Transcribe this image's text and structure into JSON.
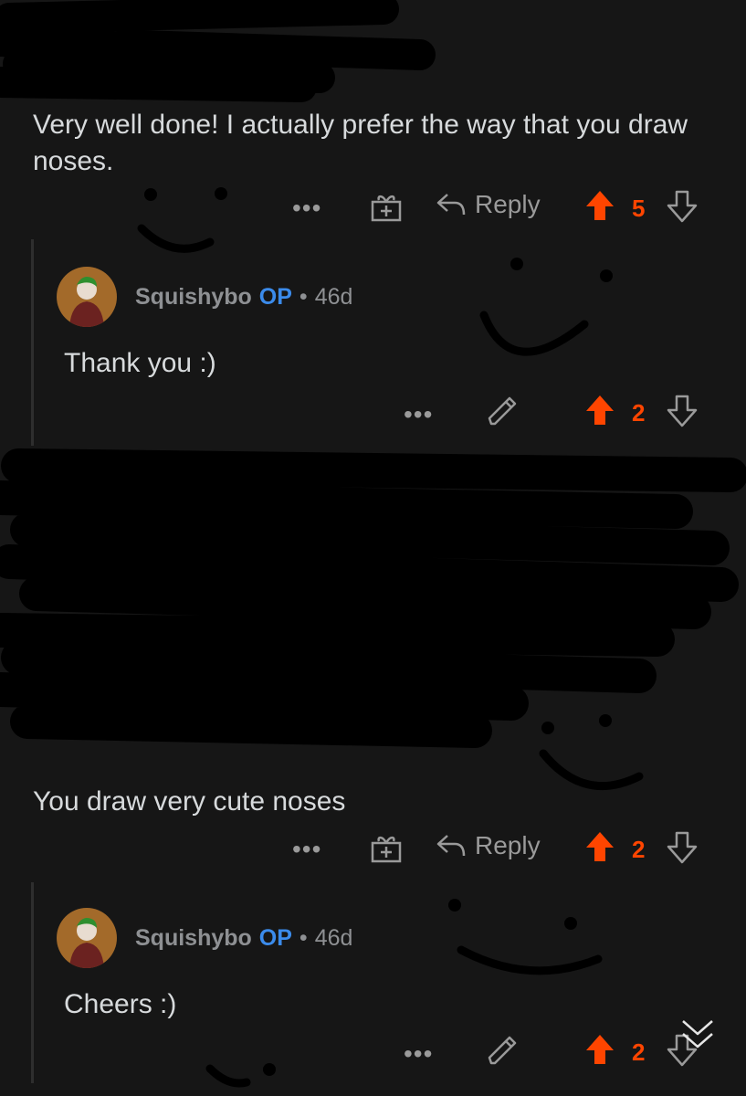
{
  "comments": [
    {
      "text": "Very well done! I actually prefer the way that you draw noses.",
      "reply_label": "Reply",
      "more_label": "•••",
      "score": "5"
    },
    {
      "author": "Squishybo",
      "op_label": "OP",
      "separator": "•",
      "age": "46d",
      "text": "Thank you :)",
      "more_label": "•••",
      "score": "2"
    },
    {
      "text": "You draw very cute noses",
      "reply_label": "Reply",
      "more_label": "•••",
      "score": "2"
    },
    {
      "author": "Squishybo",
      "op_label": "OP",
      "separator": "•",
      "age": "46d",
      "text": "Cheers :)",
      "more_label": "•••",
      "score": "2"
    }
  ],
  "icons": {
    "award": "award-icon",
    "reply": "reply-arrow-icon",
    "upvote": "upvote-arrow-icon",
    "downvote": "downvote-arrow-icon",
    "edit": "pencil-icon",
    "collapse": "collapse-chevrons-icon"
  },
  "colors": {
    "background": "#161616",
    "upvote": "#ff4500",
    "op": "#3b8beb",
    "meta": "#8e9093"
  }
}
